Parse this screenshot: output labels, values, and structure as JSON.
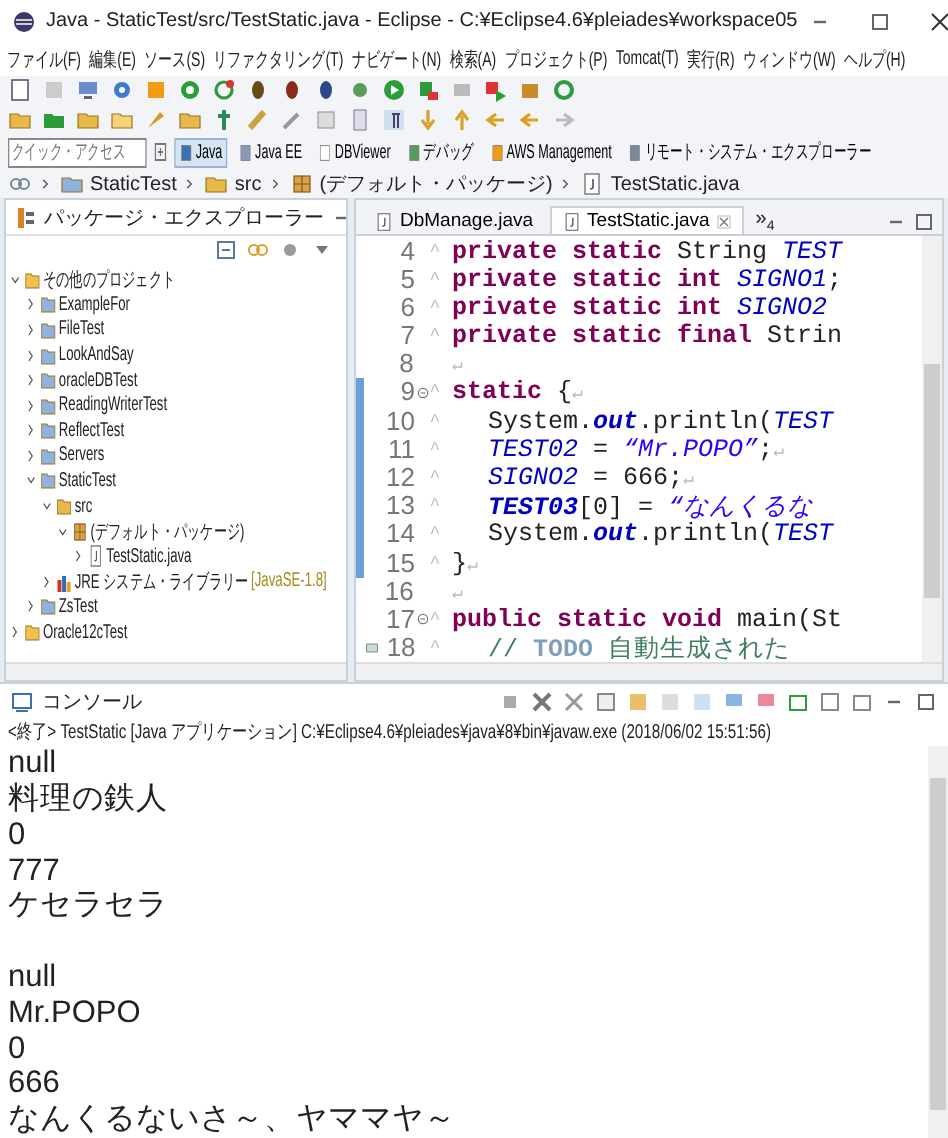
{
  "window": {
    "title": "Java - StaticTest/src/TestStatic.java - Eclipse - C:¥Eclipse4.6¥pleiades¥workspace05"
  },
  "menu": [
    "ファイル(F)",
    "編集(E)",
    "ソース(S)",
    "リファクタリング(T)",
    "ナビゲート(N)",
    "検索(A)",
    "プロジェクト(P)",
    "Tomcat(T)",
    "実行(R)",
    "ウィンドウ(W)",
    "ヘルプ(H)"
  ],
  "quick_access": {
    "placeholder": "クイック・アクセス"
  },
  "perspectives": [
    {
      "label": "Java",
      "selected": true
    },
    {
      "label": "Java EE",
      "selected": false
    },
    {
      "label": "DBViewer",
      "selected": false
    },
    {
      "label": "デバッグ",
      "selected": false
    },
    {
      "label": "AWS Management",
      "selected": false
    },
    {
      "label": "リモート・システム・エクスプローラー",
      "selected": false
    }
  ],
  "breadcrumb": [
    {
      "label": "StaticTest",
      "kind": "project"
    },
    {
      "label": "src",
      "kind": "src"
    },
    {
      "label": "(デフォルト・パッケージ)",
      "kind": "package"
    },
    {
      "label": "TestStatic.java",
      "kind": "file"
    }
  ],
  "explorer": {
    "title": "パッケージ・エクスプローラー",
    "tree": [
      {
        "label": "その他のプロジェクト",
        "kind": "group",
        "expanded": true,
        "children": [
          {
            "label": "ExampleFor",
            "kind": "project",
            "expanded": false
          },
          {
            "label": "FileTest",
            "kind": "project",
            "expanded": false
          },
          {
            "label": "LookAndSay",
            "kind": "project",
            "expanded": false
          },
          {
            "label": "oracleDBTest",
            "kind": "project",
            "expanded": false
          },
          {
            "label": "ReadingWriterTest",
            "kind": "project",
            "expanded": false
          },
          {
            "label": "ReflectTest",
            "kind": "project",
            "expanded": false
          },
          {
            "label": "Servers",
            "kind": "project",
            "expanded": false
          },
          {
            "label": "StaticTest",
            "kind": "project",
            "expanded": true,
            "children": [
              {
                "label": "src",
                "kind": "src",
                "expanded": true,
                "children": [
                  {
                    "label": "(デフォルト・パッケージ)",
                    "kind": "package",
                    "expanded": true,
                    "children": [
                      {
                        "label": "TestStatic.java",
                        "kind": "file",
                        "expanded": false
                      }
                    ]
                  }
                ]
              },
              {
                "label": "JRE システム・ライブラリー",
                "kind": "library",
                "expanded": false,
                "decoration": "[JavaSE-1.8]"
              }
            ]
          },
          {
            "label": "ZsTest",
            "kind": "project",
            "expanded": false
          }
        ]
      },
      {
        "label": "Oracle12cTest",
        "kind": "group",
        "expanded": false
      }
    ]
  },
  "editor": {
    "tabs": [
      {
        "label": "DbManage.java",
        "selected": false
      },
      {
        "label": "TestStatic.java",
        "selected": true
      }
    ],
    "overflow": "»",
    "overflow_count": "4",
    "lines": [
      {
        "number": "4",
        "inner": false,
        "marked": false,
        "fold": false,
        "indent_mark": "^",
        "segments": [
          {
            "kind": "kw",
            "text": "private static "
          },
          {
            "kind": "plain",
            "text": "String "
          },
          {
            "kind": "field",
            "text": "TEST"
          }
        ]
      },
      {
        "number": "5",
        "inner": false,
        "marked": false,
        "fold": false,
        "indent_mark": "^",
        "segments": [
          {
            "kind": "kw",
            "text": "private static int "
          },
          {
            "kind": "field",
            "text": "SIGNO1"
          },
          {
            "kind": "plain",
            "text": ";"
          }
        ]
      },
      {
        "number": "6",
        "inner": false,
        "marked": false,
        "fold": false,
        "indent_mark": "^",
        "segments": [
          {
            "kind": "kw",
            "text": "private static int "
          },
          {
            "kind": "field",
            "text": "SIGNO2"
          }
        ]
      },
      {
        "number": "7",
        "inner": false,
        "marked": false,
        "fold": false,
        "indent_mark": "^",
        "segments": [
          {
            "kind": "kw",
            "text": "private static final "
          },
          {
            "kind": "plain",
            "text": "Strin"
          }
        ]
      },
      {
        "number": "8",
        "inner": false,
        "marked": false,
        "fold": false,
        "eol": "↵"
      },
      {
        "number": "9",
        "inner": false,
        "marked": true,
        "fold": true,
        "indent_mark": "^",
        "eol": "↵",
        "segments": [
          {
            "kind": "kw",
            "text": "static "
          },
          {
            "kind": "plain",
            "text": "{"
          }
        ]
      },
      {
        "number": "10",
        "inner": true,
        "marked": true,
        "fold": false,
        "indent_mark": "^",
        "segments": [
          {
            "kind": "plain",
            "text": "System."
          },
          {
            "kind": "static_field",
            "text": "out"
          },
          {
            "kind": "plain",
            "text": ".println("
          },
          {
            "kind": "field",
            "text": "TEST"
          }
        ]
      },
      {
        "number": "11",
        "inner": true,
        "marked": true,
        "fold": false,
        "indent_mark": "^",
        "eol": "↵",
        "segments": [
          {
            "kind": "field",
            "text": "TEST02"
          },
          {
            "kind": "plain",
            "text": " = "
          },
          {
            "kind": "str",
            "text": "“Mr.POPO”"
          },
          {
            "kind": "plain",
            "text": ";"
          }
        ]
      },
      {
        "number": "12",
        "inner": true,
        "marked": true,
        "fold": false,
        "indent_mark": "^",
        "eol": "↵",
        "segments": [
          {
            "kind": "field",
            "text": "SIGNO2"
          },
          {
            "kind": "plain",
            "text": " = 666;"
          }
        ]
      },
      {
        "number": "13",
        "inner": true,
        "marked": true,
        "fold": false,
        "indent_mark": "^",
        "segments": [
          {
            "kind": "static_field",
            "text": "TEST03"
          },
          {
            "kind": "plain",
            "text": "[0] = "
          },
          {
            "kind": "str",
            "text": "“なんくるな"
          }
        ]
      },
      {
        "number": "14",
        "inner": true,
        "marked": true,
        "fold": false,
        "indent_mark": "^",
        "segments": [
          {
            "kind": "plain",
            "text": "System."
          },
          {
            "kind": "static_field",
            "text": "out"
          },
          {
            "kind": "plain",
            "text": ".println("
          },
          {
            "kind": "field",
            "text": "TEST"
          }
        ]
      },
      {
        "number": "15",
        "inner": false,
        "marked": true,
        "fold": false,
        "indent_mark": "^",
        "eol": "↵",
        "segments": [
          {
            "kind": "plain",
            "text": "}"
          }
        ]
      },
      {
        "number": "16",
        "inner": false,
        "marked": false,
        "fold": false,
        "eol": "↵"
      },
      {
        "number": "17",
        "inner": false,
        "marked": false,
        "fold": true,
        "indent_mark": "^",
        "segments": [
          {
            "kind": "kw",
            "text": "public static void "
          },
          {
            "kind": "plain",
            "text": "main(St"
          }
        ]
      },
      {
        "number": "18",
        "inner": true,
        "marked": false,
        "fold": false,
        "task": true,
        "indent_mark": "^",
        "segments": [
          {
            "kind": "comment",
            "text": "// "
          },
          {
            "kind": "task",
            "text": "TODO"
          },
          {
            "kind": "comment",
            "text": " 自動生成された"
          }
        ]
      }
    ]
  },
  "console": {
    "title": "コンソール",
    "status": "<終了> TestStatic [Java アプリケーション] C:¥Eclipse4.6¥pleiades¥java¥8¥bin¥javaw.exe (2018/06/02 15:51:56)",
    "output_blocks": [
      [
        "null",
        "料理の鉄人",
        "0",
        "777",
        "ケセラセラ"
      ],
      [
        "null",
        "Mr.POPO",
        "0",
        "666",
        "なんくるないさ～、ヤママヤ～"
      ]
    ]
  }
}
